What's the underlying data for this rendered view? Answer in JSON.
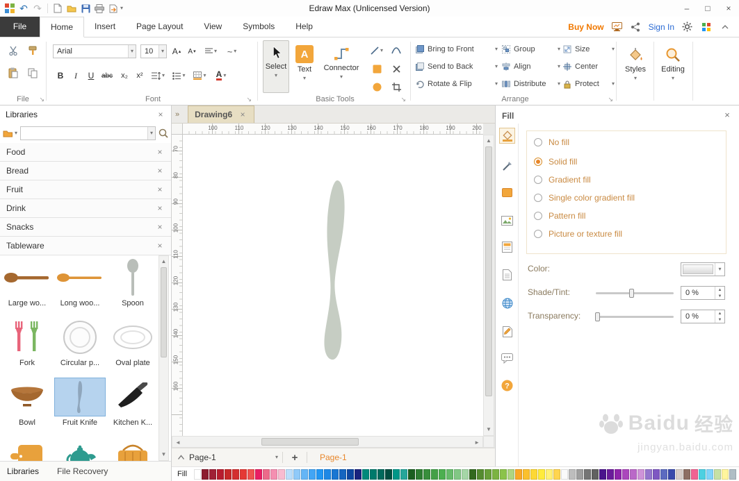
{
  "titlebar": {
    "title": "Edraw Max (Unlicensed Version)"
  },
  "menubar": {
    "tabs": [
      {
        "label": "File"
      },
      {
        "label": "Home"
      },
      {
        "label": "Insert"
      },
      {
        "label": "Page Layout"
      },
      {
        "label": "View"
      },
      {
        "label": "Symbols"
      },
      {
        "label": "Help"
      }
    ],
    "buy_now": "Buy Now",
    "sign_in": "Sign In"
  },
  "ribbon": {
    "file_group_label": "File",
    "font": {
      "family": "Arial",
      "size": "10",
      "bold": "B",
      "italic": "I",
      "underline": "U",
      "strike": "abc",
      "subscript": "x₂",
      "superscript": "x²",
      "color_letter": "A",
      "group_label": "Font"
    },
    "basic_tools": {
      "select": "Select",
      "text": "Text",
      "text_letter": "A",
      "connector": "Connector",
      "group_label": "Basic Tools"
    },
    "arrange": {
      "buttons": [
        "Bring to Front",
        "Send to Back",
        "Rotate & Flip",
        "Group",
        "Align",
        "Distribute",
        "Size",
        "Center",
        "Protect"
      ],
      "group_label": "Arrange"
    },
    "styles_label": "Styles",
    "editing_label": "Editing"
  },
  "libraries": {
    "title": "Libraries",
    "sections": [
      {
        "label": "Food"
      },
      {
        "label": "Bread"
      },
      {
        "label": "Fruit"
      },
      {
        "label": "Drink"
      },
      {
        "label": "Snacks"
      },
      {
        "label": "Tableware"
      }
    ],
    "items": [
      {
        "label": "Large wo..."
      },
      {
        "label": "Long woo..."
      },
      {
        "label": "Spoon"
      },
      {
        "label": "Fork"
      },
      {
        "label": "Circular p..."
      },
      {
        "label": "Oval plate"
      },
      {
        "label": "Bowl"
      },
      {
        "label": "Fruit Knife"
      },
      {
        "label": "Kitchen K..."
      }
    ],
    "footer": {
      "libraries_tab": "Libraries",
      "file_recovery_tab": "File Recovery"
    }
  },
  "canvas": {
    "tab": "Drawing6",
    "h_ruler": [
      "100",
      "110",
      "120",
      "130",
      "140",
      "150",
      "160",
      "170",
      "180",
      "190",
      "200"
    ],
    "v_ruler": [
      "70",
      "80",
      "90",
      "100",
      "110",
      "120",
      "130",
      "140",
      "150",
      "160"
    ],
    "page_dropdown": "Page-1",
    "add_page": "+",
    "page_tab": "Page-1"
  },
  "color_bar": {
    "label": "Fill",
    "colors": [
      "#FFFFFF",
      "#8C1D2F",
      "#A02036",
      "#B71C2E",
      "#C62828",
      "#D32F2F",
      "#E53935",
      "#EF5350",
      "#E91E63",
      "#EC6A8A",
      "#F48FB1",
      "#F8BBD0",
      "#BBDEFB",
      "#90CAF9",
      "#64B5F6",
      "#42A5F5",
      "#2196F3",
      "#1E88E5",
      "#1976D2",
      "#1565C0",
      "#0D47A1",
      "#1A237E",
      "#00897B",
      "#00796B",
      "#00695C",
      "#004D40",
      "#009688",
      "#26A69A",
      "#1B5E20",
      "#2E7D32",
      "#388E3C",
      "#43A047",
      "#4CAF50",
      "#66BB6A",
      "#81C784",
      "#A5D6A7",
      "#33691E",
      "#558B2F",
      "#689F38",
      "#7CB342",
      "#8BC34A",
      "#AED581",
      "#F9A825",
      "#FBC02D",
      "#FDD835",
      "#FFEB3B",
      "#FFF176",
      "#FFD54F",
      "#FAFAFA",
      "#BDBDBD",
      "#9E9E9E",
      "#757575",
      "#616161",
      "#4A148C",
      "#6A1B9A",
      "#8E24AA",
      "#AB47BC",
      "#BA68C8",
      "#CE93D8",
      "#9575CD",
      "#7E57C2",
      "#5C6BC0",
      "#3949AB",
      "#D7CCC8",
      "#8D6E63",
      "#F06292",
      "#4DD0E1",
      "#81D4FA",
      "#C5E1A5",
      "#FFF59D",
      "#B0BEC5"
    ]
  },
  "fill_panel": {
    "title": "Fill",
    "options": [
      {
        "label": "No fill",
        "selected": false
      },
      {
        "label": "Solid fill",
        "selected": true
      },
      {
        "label": "Gradient fill",
        "selected": false
      },
      {
        "label": "Single color gradient fill",
        "selected": false
      },
      {
        "label": "Pattern fill",
        "selected": false
      },
      {
        "label": "Picture or texture fill",
        "selected": false
      }
    ],
    "color_label": "Color:",
    "shade_label": "Shade/Tint:",
    "shade_value": "0 %",
    "transparency_label": "Transparency:",
    "transparency_value": "0 %"
  },
  "watermark": {
    "brand": "Baidu",
    "brand_cn": "经验",
    "url": "jingyan.baidu.com"
  },
  "colors": {
    "accent": "#F2A63B",
    "accent_dark": "#E8862A",
    "selected_blue": "#B6D3EE",
    "knife": "#C6CDC3"
  }
}
